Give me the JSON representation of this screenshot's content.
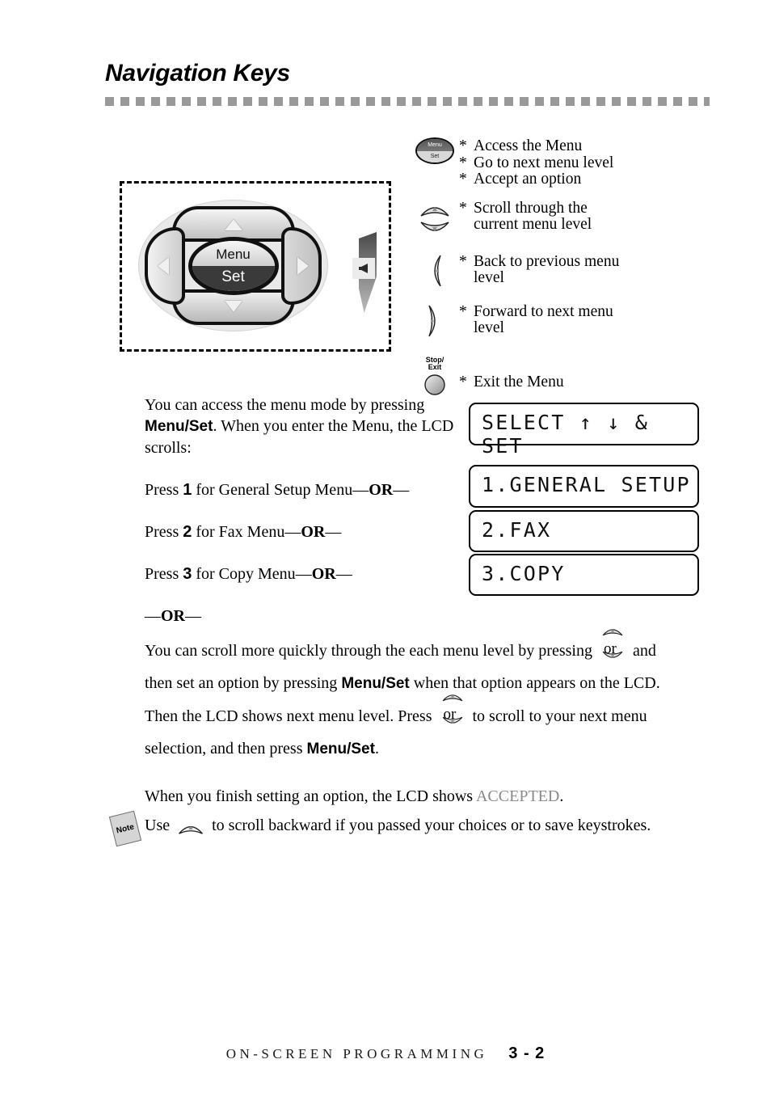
{
  "header": {
    "title": "Navigation Keys"
  },
  "diagram": {
    "navpad": {
      "center_top_label": "Menu",
      "center_bottom_label": "Set",
      "up_icon": "up-arrow-key",
      "down_icon": "down-arrow-key",
      "left_icon": "left-arrow-key",
      "right_icon": "right-arrow-key",
      "speaker_icon": "speaker-volume-icon"
    }
  },
  "legend": {
    "rows": [
      {
        "icon": "menu-set-key-icon",
        "icon_top_label": "Menu",
        "icon_bottom_label": "Set",
        "lines": [
          "Access the Menu",
          "Go to next menu level",
          "Accept an option"
        ],
        "bullet": "*"
      },
      {
        "icon": "scroll-up-down-keys-icon",
        "lines": [
          "Scroll through the",
          "current menu level"
        ],
        "bullet": "*"
      },
      {
        "icon": "left-arrow-key-icon",
        "lines": [
          "Back to previous menu",
          "level"
        ],
        "bullet": "*"
      },
      {
        "icon": "right-arrow-key-icon",
        "lines": [
          "Forward to next menu",
          "level"
        ],
        "bullet": "*"
      },
      {
        "icon": "stop-exit-key-icon",
        "icon_label_line1": "Stop/",
        "icon_label_line2": "Exit",
        "lines": [
          "Exit the Menu"
        ],
        "bullet": "*"
      }
    ]
  },
  "body": {
    "p1_a": "You can access the menu mode by pressing ",
    "p1_menuset": "Menu/Set",
    "p1_b": ". When you enter the Menu, the LCD scrolls:",
    "p2_a": "Press ",
    "p2_num": "1",
    "p2_b": " for General Setup Menu",
    "p2_or": "OR",
    "p3_a": "Press ",
    "p3_num": "2",
    "p3_b": " for Fax Menu",
    "p3_or": "OR",
    "p4_a": "Press ",
    "p4_num": "3",
    "p4_b": " for Copy Menu",
    "p4_or": "OR",
    "p5_or": "OR",
    "dash": "—"
  },
  "lcd": {
    "screens": [
      {
        "name": "lcd-select-set",
        "text": "SELECT ↑ ↓ & SET"
      },
      {
        "name": "lcd-general-setup",
        "text": "1.GENERAL SETUP"
      },
      {
        "name": "lcd-fax",
        "text": "2.FAX"
      },
      {
        "name": "lcd-copy",
        "text": "3.COPY"
      }
    ]
  },
  "wide": {
    "l1_a": "You can scroll more quickly through the each menu level by pressing ",
    "l1_or": "or",
    "l1_b": " and",
    "l2_a": "then set an option by pressing ",
    "l2_menuset": "Menu/Set",
    "l2_b": " when that option appears on the LCD.",
    "l3_a": "Then the LCD shows next menu level. Press ",
    "l3_or": "or",
    "l3_b": " to scroll to your next menu",
    "l4_a": "selection, and then press ",
    "l4_menuset": "Menu/Set",
    "l4_b": "."
  },
  "accepted": {
    "text_a": "When you finish setting an option, the LCD shows ",
    "highlight": "ACCEPTED",
    "text_b": ".",
    "highlight_color": "#8a8a8a"
  },
  "note": {
    "tag_label": "Note",
    "text_a": "Use ",
    "text_b": " to scroll backward if you passed your choices or to save keystrokes."
  },
  "footer": {
    "title": "ON-SCREEN PROGRAMMING",
    "page": "3 - 2"
  }
}
